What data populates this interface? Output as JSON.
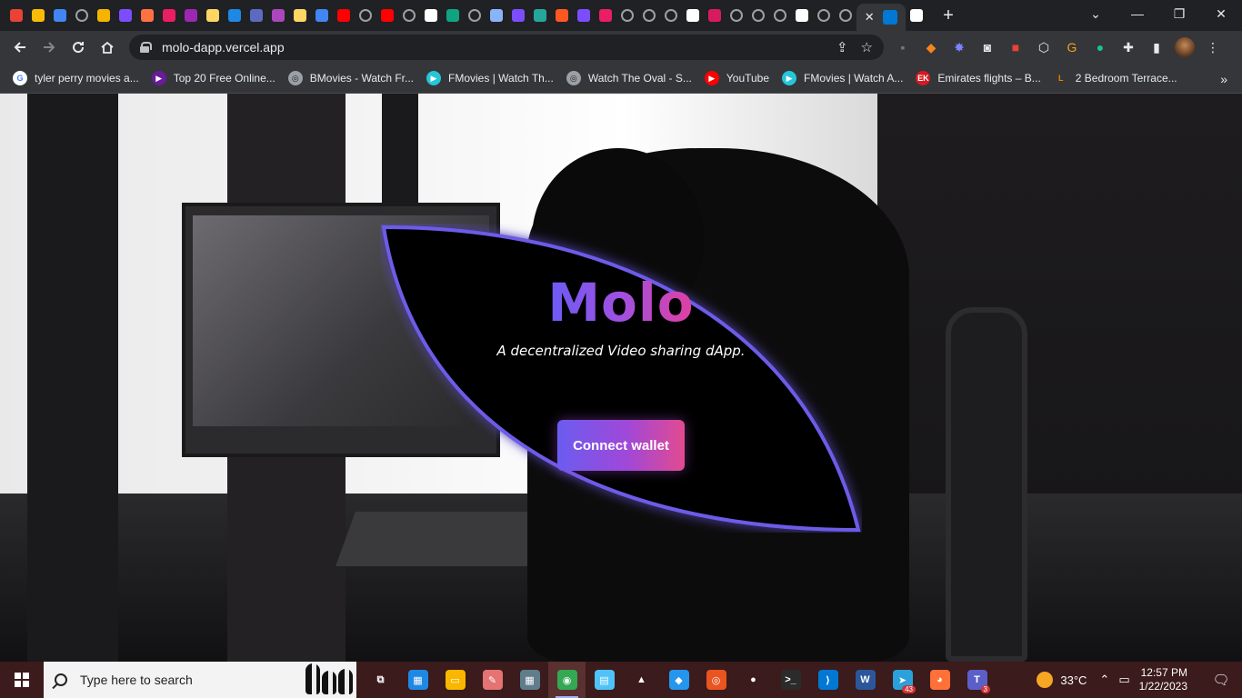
{
  "browser": {
    "tab_favicon_colors": [
      "#ea4335",
      "#fbbc05",
      "#4285f4",
      "#9aa0a6",
      "#f4b400",
      "#7c4dff",
      "#ff7043",
      "#e91e63",
      "#9c27b0",
      "#fdd663",
      "#1e88e5",
      "#5c6bc0",
      "#ab47bc",
      "#fdd663",
      "#4285f4",
      "#ff0000",
      "#9aa0a6",
      "#ff0000",
      "#9aa0a6",
      "#ffffff",
      "#10a37f",
      "#9aa0a6",
      "#8ab4f8",
      "#7c4dff",
      "#26a69a",
      "#ff5722",
      "#7c4dff",
      "#e91e63",
      "#9aa0a6",
      "#9aa0a6",
      "#9aa0a6",
      "#ffffff",
      "#d81b60",
      "#9aa0a6",
      "#9aa0a6",
      "#9aa0a6",
      "#ffffff",
      "#9aa0a6",
      "#9aa0a6",
      "#ffffff"
    ],
    "active_tab_close": "✕",
    "new_tab": "+",
    "window_controls": {
      "dropdown": "⌄",
      "minimize": "—",
      "restore": "❐",
      "close": "✕"
    },
    "url": "molo-dapp.vercel.app",
    "share_icon": "⇪",
    "star_icon": "☆"
  },
  "bookmarks": [
    {
      "label": "tyler perry movies a...",
      "icon": "G",
      "color": "#ffffff",
      "text_color": "#4285f4"
    },
    {
      "label": "Top 20 Free Online...",
      "icon": "▶",
      "color": "#6a1b9a",
      "text_color": "#ffffff"
    },
    {
      "label": "BMovies - Watch Fr...",
      "icon": "◎",
      "color": "#9aa0a6",
      "text_color": "#202124"
    },
    {
      "label": "FMovies | Watch Th...",
      "icon": "▶",
      "color": "#26c6da",
      "text_color": "#ffffff"
    },
    {
      "label": "Watch The Oval - S...",
      "icon": "◎",
      "color": "#9aa0a6",
      "text_color": "#202124"
    },
    {
      "label": "YouTube",
      "icon": "▶",
      "color": "#ff0000",
      "text_color": "#ffffff"
    },
    {
      "label": "FMovies | Watch A...",
      "icon": "▶",
      "color": "#26c6da",
      "text_color": "#ffffff"
    },
    {
      "label": "Emirates flights – B...",
      "icon": "EK",
      "color": "#d71921",
      "text_color": "#ffffff"
    },
    {
      "label": "2 Bedroom Terrace...",
      "icon": "L",
      "color": "#35363a",
      "text_color": "#f57c00"
    }
  ],
  "bookmarks_more": "»",
  "hero": {
    "title": "Molo",
    "subtitle": "A decentralized Video sharing dApp.",
    "button_label": "Connect wallet",
    "accent_start": "#6a5cf5",
    "accent_end": "#e34a8f"
  },
  "taskbar": {
    "search_placeholder": "Type here to search",
    "apps": [
      {
        "name": "task-view-icon",
        "glyph": "⧉",
        "color": "#3b1b1b"
      },
      {
        "name": "store-icon",
        "glyph": "▦",
        "color": "#1e88e5"
      },
      {
        "name": "file-explorer-icon",
        "glyph": "▭",
        "color": "#f9b700"
      },
      {
        "name": "paint-icon",
        "glyph": "✎",
        "color": "#e57373"
      },
      {
        "name": "calculator-icon",
        "glyph": "▦",
        "color": "#607d8b"
      },
      {
        "name": "chrome-icon",
        "glyph": "◉",
        "color": "#34a853"
      },
      {
        "name": "notepad-icon",
        "glyph": "▤",
        "color": "#4fc3f7"
      },
      {
        "name": "linux-icon",
        "glyph": "▲",
        "color": "#3b1b1b"
      },
      {
        "name": "docker-icon",
        "glyph": "◆",
        "color": "#2496ed"
      },
      {
        "name": "ubuntu-icon",
        "glyph": "◎",
        "color": "#e95420"
      },
      {
        "name": "penguin-icon",
        "glyph": "●",
        "color": "#3b1b1b"
      },
      {
        "name": "terminal-icon",
        "glyph": ">_",
        "color": "#2b2b2b"
      },
      {
        "name": "vscode-icon",
        "glyph": "⟩",
        "color": "#0078d4"
      },
      {
        "name": "word-icon",
        "glyph": "W",
        "color": "#2b579a"
      },
      {
        "name": "telegram-icon",
        "glyph": "➤",
        "color": "#2aa1da",
        "badge": "43"
      },
      {
        "name": "firefox-icon",
        "glyph": "◕",
        "color": "#ff7139"
      },
      {
        "name": "teams-icon",
        "glyph": "T",
        "color": "#5b5fc7",
        "badge": "3"
      }
    ],
    "weather_temp": "33°C",
    "tray_up": "⌃",
    "tray_net": "▭",
    "time": "12:57 PM",
    "date": "1/22/2023",
    "notifications": "🗨"
  }
}
